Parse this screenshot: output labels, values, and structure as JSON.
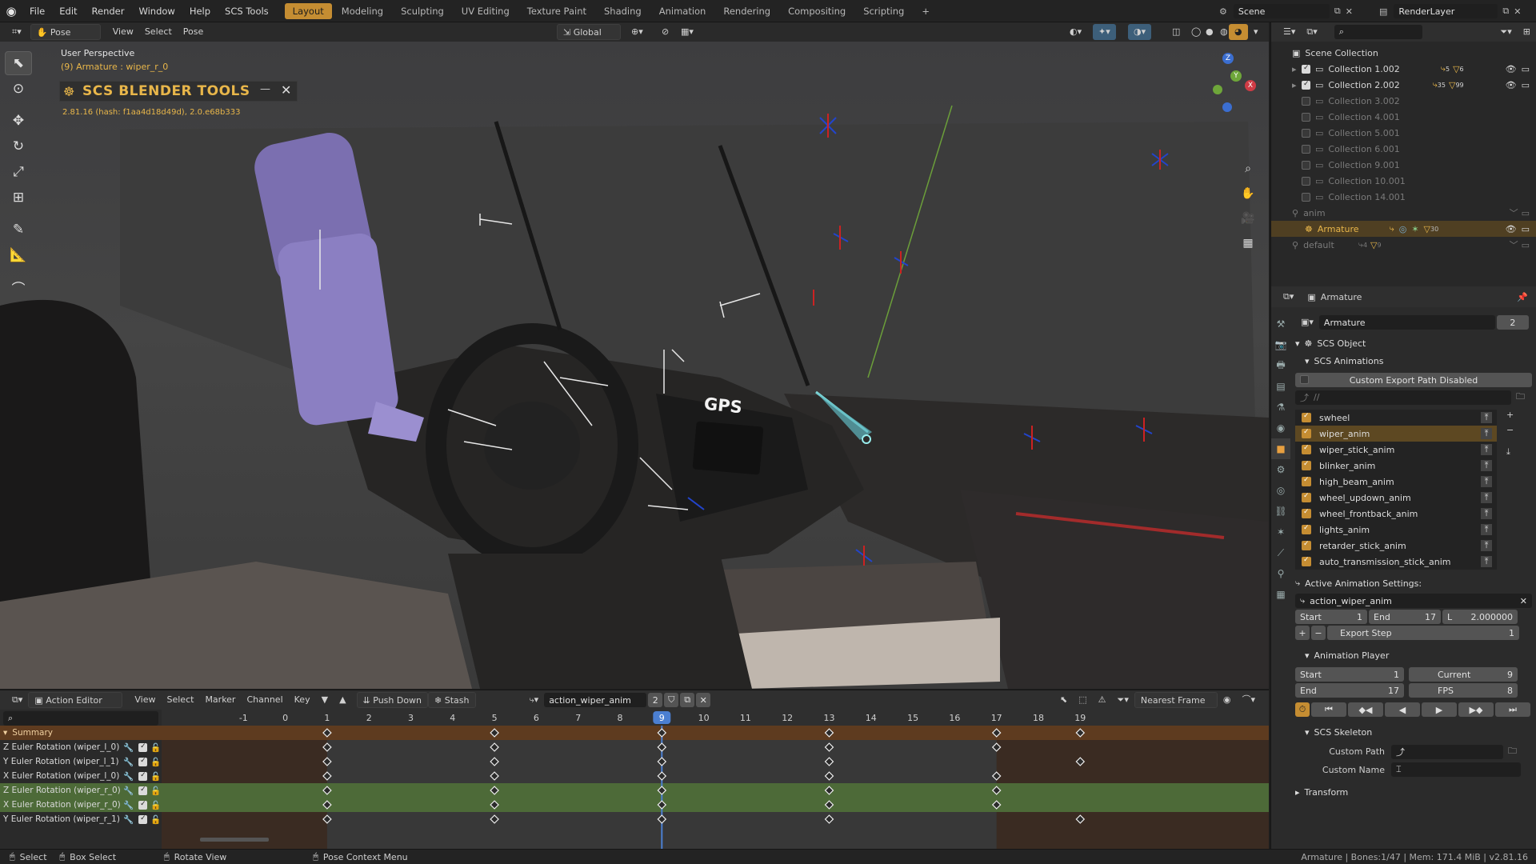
{
  "topbar": {
    "menus": [
      "File",
      "Edit",
      "Render",
      "Window",
      "Help",
      "SCS Tools"
    ],
    "workspaces": [
      "Layout",
      "Modeling",
      "Sculpting",
      "UV Editing",
      "Texture Paint",
      "Shading",
      "Animation",
      "Rendering",
      "Compositing",
      "Scripting"
    ],
    "active_workspace": "Layout",
    "scene_label": "Scene",
    "render_layer_label": "RenderLayer"
  },
  "viewport_header": {
    "mode": "Pose Mode",
    "menus": [
      "View",
      "Select",
      "Pose"
    ],
    "orientation": "Global"
  },
  "viewport": {
    "perspective_label": "User Perspective",
    "object_label": "(9) Armature : wiper_r_0",
    "scs_panel": {
      "title": "SCS BLENDER TOOLS",
      "version": "2.81.16 (hash: f1aa4d18d49d), 2.0.e68b333"
    },
    "gps_label": "GPS",
    "gizmo_axes": [
      "Z",
      "Y",
      "X"
    ]
  },
  "outliner": {
    "root": "Scene Collection",
    "items": [
      {
        "label": "Collection 1.002",
        "checked": true,
        "dim": false,
        "count_a": "5",
        "count_b": "6"
      },
      {
        "label": "Collection 2.002",
        "checked": true,
        "dim": false,
        "count_a": "35",
        "count_b": "99"
      },
      {
        "label": "Collection 3.002",
        "checked": false,
        "dim": true
      },
      {
        "label": "Collection 4.001",
        "checked": false,
        "dim": true
      },
      {
        "label": "Collection 5.001",
        "checked": false,
        "dim": true
      },
      {
        "label": "Collection 6.001",
        "checked": false,
        "dim": true
      },
      {
        "label": "Collection 9.001",
        "checked": false,
        "dim": true
      },
      {
        "label": "Collection 10.001",
        "checked": false,
        "dim": true
      },
      {
        "label": "Collection 14.001",
        "checked": false,
        "dim": true
      }
    ],
    "anim_label": "anim",
    "armature_label": "Armature",
    "armature_count": "30",
    "default_label": "default",
    "default_counts": [
      "4",
      "9"
    ]
  },
  "properties": {
    "header_object": "Armature",
    "datablock": "Armature",
    "datablock_users": "2",
    "scs_object_label": "SCS Object",
    "scs_animations_label": "SCS Animations",
    "custom_export_label": "Custom Export Path Disabled",
    "path_placeholder": "//",
    "animations": [
      "swheel",
      "wiper_anim",
      "wiper_stick_anim",
      "blinker_anim",
      "high_beam_anim",
      "wheel_updown_anim",
      "wheel_frontback_anim",
      "lights_anim",
      "retarder_stick_anim",
      "auto_transmission_stick_anim"
    ],
    "selected_animation": "wiper_anim",
    "active_settings_label": "Active Animation Settings:",
    "active_action": "action_wiper_anim",
    "start_label": "Start",
    "start_value": "1",
    "end_label": "End",
    "end_value": "17",
    "length_label": "L",
    "length_value": "2.000000",
    "export_step_label": "Export Step",
    "export_step_value": "1",
    "anim_player_label": "Animation Player",
    "player_start_label": "Start",
    "player_start": "1",
    "player_end_label": "End",
    "player_end": "17",
    "current_label": "Current",
    "current": "9",
    "fps_label": "FPS",
    "fps": "8",
    "skeleton_label": "SCS Skeleton",
    "custom_path_label": "Custom Path",
    "custom_name_label": "Custom Name",
    "transform_label": "Transform"
  },
  "action_editor": {
    "editor_type": "Action Editor",
    "menus": [
      "View",
      "Select",
      "Marker",
      "Channel",
      "Key"
    ],
    "push_down_label": "Push Down",
    "stash_label": "Stash",
    "action_name": "action_wiper_anim",
    "action_users": "2",
    "snap_mode": "Nearest Frame",
    "frames": [
      "-1",
      "0",
      "1",
      "2",
      "3",
      "4",
      "5",
      "6",
      "7",
      "8",
      "9",
      "10",
      "11",
      "12",
      "13",
      "14",
      "15",
      "16",
      "17",
      "18",
      "19"
    ],
    "current_frame": "9",
    "summary_label": "Summary",
    "channels": [
      {
        "label": "Z Euler Rotation (wiper_l_0)",
        "green": false,
        "keys": [
          1,
          5,
          9,
          13,
          17
        ]
      },
      {
        "label": "Y Euler Rotation (wiper_l_1)",
        "green": false,
        "keys": [
          1,
          5,
          9,
          13,
          19
        ]
      },
      {
        "label": "X Euler Rotation (wiper_l_0)",
        "green": false,
        "keys": [
          1,
          5,
          9,
          13,
          17
        ]
      },
      {
        "label": "Z Euler Rotation (wiper_r_0)",
        "green": true,
        "keys": [
          1,
          5,
          9,
          13,
          17
        ]
      },
      {
        "label": "X Euler Rotation (wiper_r_0)",
        "green": true,
        "keys": [
          1,
          5,
          9,
          13,
          17
        ]
      },
      {
        "label": "Y Euler Rotation (wiper_r_1)",
        "green": false,
        "keys": [
          1,
          5,
          9,
          13,
          19
        ]
      }
    ],
    "summary_keys": [
      1,
      5,
      9,
      13,
      17,
      19
    ]
  },
  "statusbar": {
    "select": "Select",
    "box_select": "Box Select",
    "rotate_view": "Rotate View",
    "context_menu": "Pose Context Menu",
    "info": "Armature | Bones:1/47 | Mem: 171.4 MiB | v2.81.16"
  }
}
